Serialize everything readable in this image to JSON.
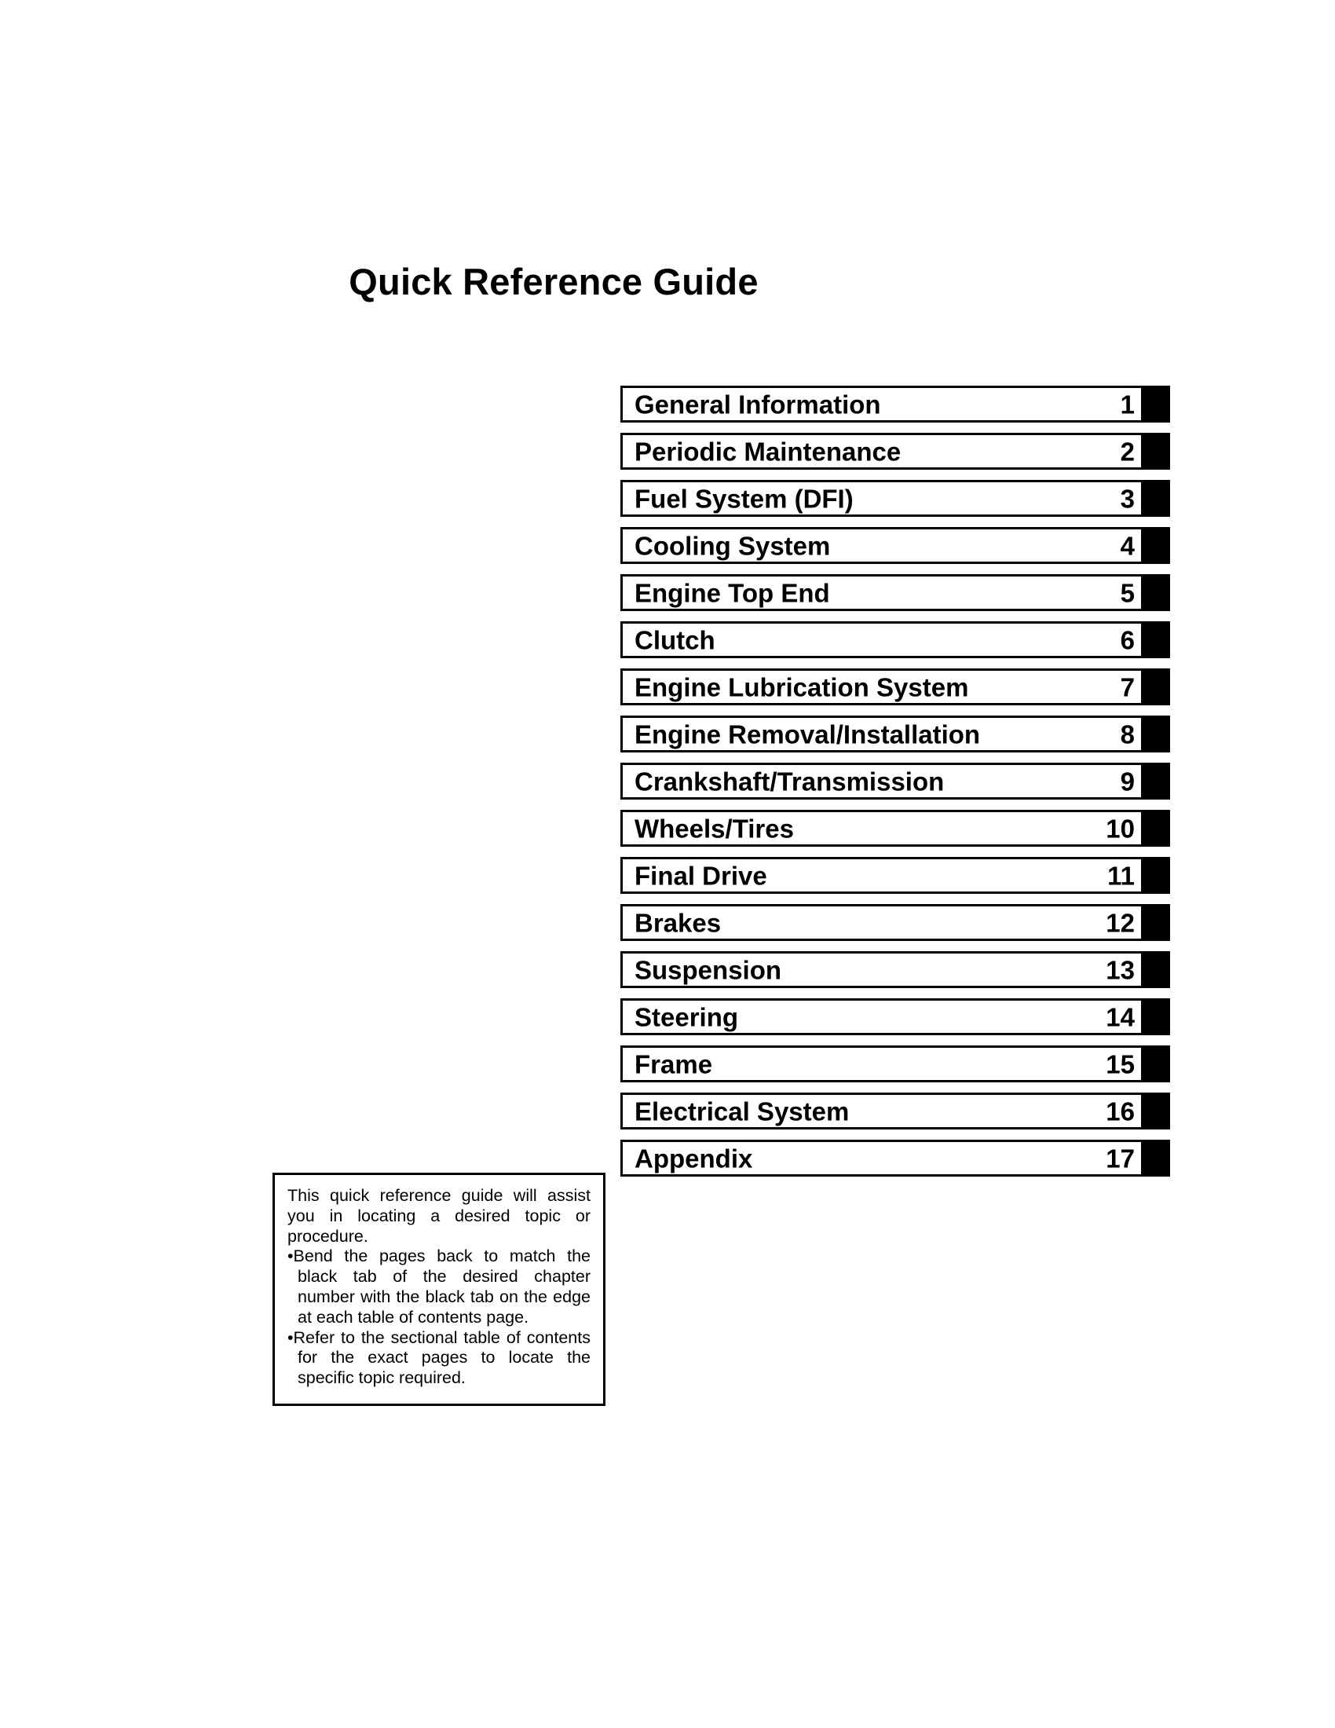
{
  "document": {
    "title": "Quick Reference Guide"
  },
  "chapters": [
    {
      "title": "General Information",
      "number": "1"
    },
    {
      "title": "Periodic Maintenance",
      "number": "2"
    },
    {
      "title": "Fuel System (DFI)",
      "number": "3"
    },
    {
      "title": "Cooling System",
      "number": "4"
    },
    {
      "title": "Engine Top End",
      "number": "5"
    },
    {
      "title": "Clutch",
      "number": "6"
    },
    {
      "title": "Engine Lubrication System",
      "number": "7"
    },
    {
      "title": "Engine Removal/Installation",
      "number": "8"
    },
    {
      "title": "Crankshaft/Transmission",
      "number": "9"
    },
    {
      "title": "Wheels/Tires",
      "number": "10"
    },
    {
      "title": "Final Drive",
      "number": "11"
    },
    {
      "title": "Brakes",
      "number": "12"
    },
    {
      "title": "Suspension",
      "number": "13"
    },
    {
      "title": "Steering",
      "number": "14"
    },
    {
      "title": "Frame",
      "number": "15"
    },
    {
      "title": "Electrical System",
      "number": "16"
    },
    {
      "title": "Appendix",
      "number": "17"
    }
  ],
  "note": {
    "intro": "This quick reference guide will assist you in locating a desired topic or procedure.",
    "bullets": [
      "•Bend the pages back to match the black tab of the desired chapter number with the black tab on the edge at each table of contents page.",
      "•Refer to the sectional table of contents for the exact pages to locate the specific topic required."
    ]
  },
  "colors": {
    "ink": "#000000",
    "paper": "#ffffff",
    "tab": "#000000"
  }
}
